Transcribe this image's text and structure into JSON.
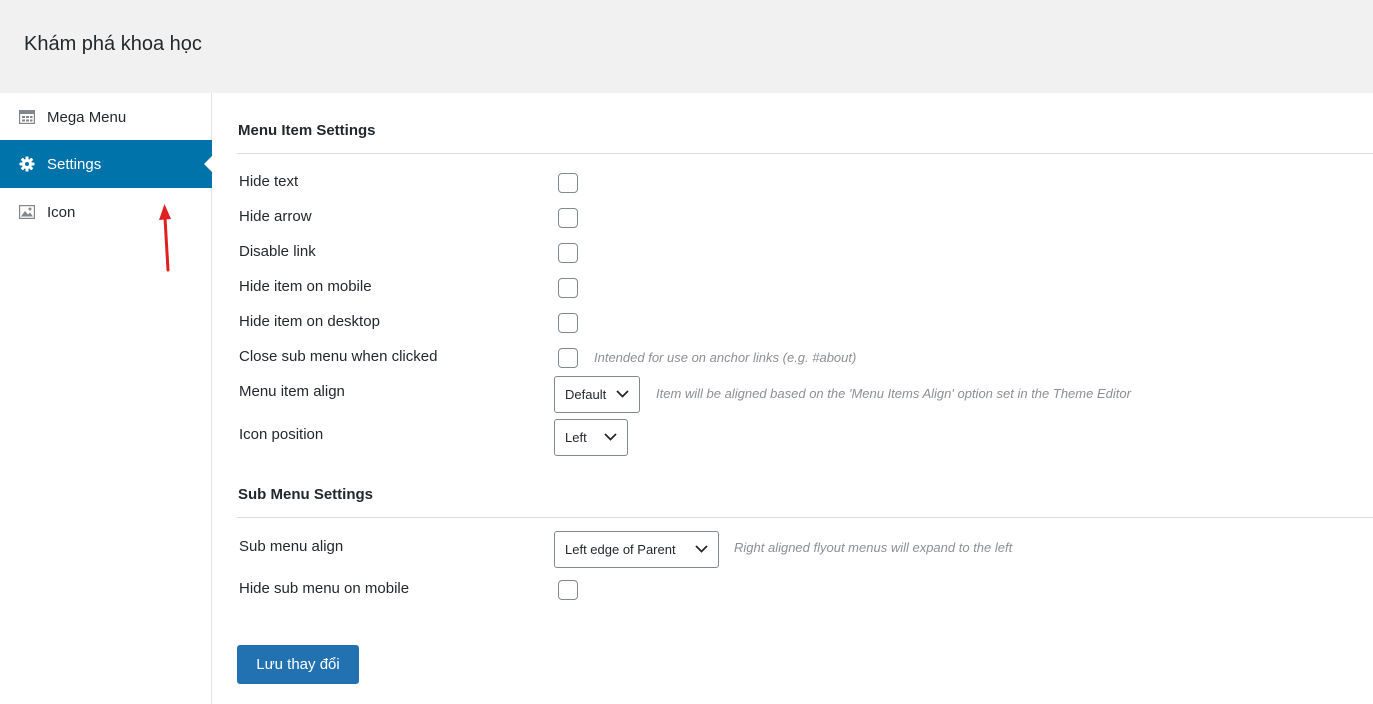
{
  "header": {
    "title": "Khám phá khoa học"
  },
  "sidebar": {
    "items": [
      {
        "label": "Mega Menu",
        "icon": "grid-menu-icon",
        "active": false
      },
      {
        "label": "Settings",
        "icon": "gear-icon",
        "active": true
      },
      {
        "label": "Icon",
        "icon": "image-icon",
        "active": false
      }
    ]
  },
  "menu_item_settings": {
    "title": "Menu Item Settings",
    "rows": [
      {
        "label": "Hide text",
        "type": "checkbox",
        "checked": false
      },
      {
        "label": "Hide arrow",
        "type": "checkbox",
        "checked": false
      },
      {
        "label": "Disable link",
        "type": "checkbox",
        "checked": false
      },
      {
        "label": "Hide item on mobile",
        "type": "checkbox",
        "checked": false
      },
      {
        "label": "Hide item on desktop",
        "type": "checkbox",
        "checked": false
      },
      {
        "label": "Close sub menu when clicked",
        "type": "checkbox",
        "checked": false,
        "hint": "Intended for use on anchor links (e.g. #about)"
      },
      {
        "label": "Menu item align",
        "type": "select",
        "value": "Default",
        "hint": "Item will be aligned based on the 'Menu Items Align' option set in the Theme Editor"
      },
      {
        "label": "Icon position",
        "type": "select",
        "value": "Left"
      }
    ]
  },
  "sub_menu_settings": {
    "title": "Sub Menu Settings",
    "rows": [
      {
        "label": "Sub menu align",
        "type": "select",
        "value": "Left edge of Parent",
        "hint": "Right aligned flyout menus will expand to the left"
      },
      {
        "label": "Hide sub menu on mobile",
        "type": "checkbox",
        "checked": false
      }
    ]
  },
  "actions": {
    "save_label": "Lưu thay đổi"
  },
  "colors": {
    "accent": "#0073aa",
    "button": "#2271b1",
    "annotation_arrow": "#e02020"
  }
}
